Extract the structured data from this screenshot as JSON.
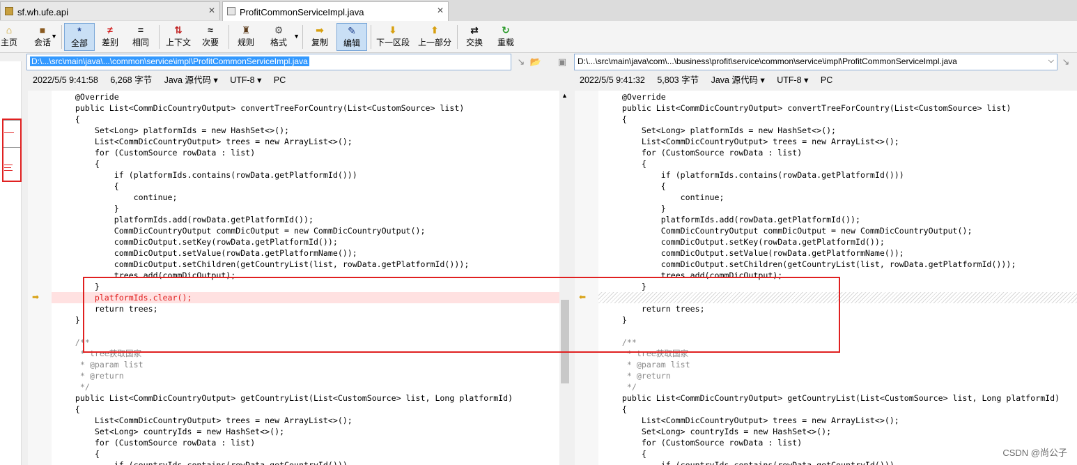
{
  "tabs": [
    {
      "label": "sf.wh.ufe.api"
    },
    {
      "label": "ProfitCommonServiceImpl.java"
    }
  ],
  "toolbar": {
    "home": "主页",
    "session": "会话",
    "all": "全部",
    "diff": "差别",
    "same": "相同",
    "context": "上下文",
    "minor": "次要",
    "rules": "规则",
    "format": "格式",
    "copy": "复制",
    "edit": "编辑",
    "next": "下一区段",
    "prev": "上一部分",
    "swap": "交换",
    "reload": "重载"
  },
  "left": {
    "path": "D:\\...\\src\\main\\java\\...\\common\\service\\impl\\ProfitCommonServiceImpl.java",
    "datetime": "2022/5/5 9:41:58",
    "size": "6,268 字节",
    "lang": "Java 源代码",
    "encoding": "UTF-8",
    "eol": "PC"
  },
  "right": {
    "path": "D:\\...\\src\\main\\java\\com\\...\\business\\profit\\service\\common\\service\\impl\\ProfitCommonServiceImpl.java",
    "datetime": "2022/5/5 9:41:32",
    "size": "5,803 字节",
    "lang": "Java 源代码",
    "encoding": "UTF-8",
    "eol": "PC"
  },
  "code_left": [
    "    @Override",
    "    public List<CommDicCountryOutput> convertTreeForCountry(List<CustomSource> list)",
    "    {",
    "        Set<Long> platformIds = new HashSet<>();",
    "        List<CommDicCountryOutput> trees = new ArrayList<>();",
    "        for (CustomSource rowData : list)",
    "        {",
    "            if (platformIds.contains(rowData.getPlatformId()))",
    "            {",
    "                continue;",
    "            }",
    "            platformIds.add(rowData.getPlatformId());",
    "            CommDicCountryOutput commDicOutput = new CommDicCountryOutput();",
    "            commDicOutput.setKey(rowData.getPlatformId());",
    "            commDicOutput.setValue(rowData.getPlatformName());",
    "            commDicOutput.setChildren(getCountryList(list, rowData.getPlatformId()));",
    "            trees.add(commDicOutput);",
    "        }",
    "        platformIds.clear();",
    "        return trees;",
    "    }",
    "",
    "    /**",
    "     * tree获取国家",
    "     * @param list",
    "     * @return",
    "     */",
    "    public List<CommDicCountryOutput> getCountryList(List<CustomSource> list, Long platformId)",
    "    {",
    "        List<CommDicCountryOutput> trees = new ArrayList<>();",
    "        Set<Long> countryIds = new HashSet<>();",
    "        for (CustomSource rowData : list)",
    "        {",
    "            if (countryIds.contains(rowData.getCountryId()))"
  ],
  "code_right": [
    "    @Override",
    "    public List<CommDicCountryOutput> convertTreeForCountry(List<CustomSource> list)",
    "    {",
    "        Set<Long> platformIds = new HashSet<>();",
    "        List<CommDicCountryOutput> trees = new ArrayList<>();",
    "        for (CustomSource rowData : list)",
    "        {",
    "            if (platformIds.contains(rowData.getPlatformId()))",
    "            {",
    "                continue;",
    "            }",
    "            platformIds.add(rowData.getPlatformId());",
    "            CommDicCountryOutput commDicOutput = new CommDicCountryOutput();",
    "            commDicOutput.setKey(rowData.getPlatformId());",
    "            commDicOutput.setValue(rowData.getPlatformName());",
    "            commDicOutput.setChildren(getCountryList(list, rowData.getPlatformId()));",
    "            trees.add(commDicOutput);",
    "        }",
    "",
    "        return trees;",
    "    }",
    "",
    "    /**",
    "     * tree获取国家",
    "     * @param list",
    "     * @return",
    "     */",
    "    public List<CommDicCountryOutput> getCountryList(List<CustomSource> list, Long platformId)",
    "    {",
    "        List<CommDicCountryOutput> trees = new ArrayList<>();",
    "        Set<Long> countryIds = new HashSet<>();",
    "        for (CustomSource rowData : list)",
    "        {",
    "            if (countryIds.contains(rowData.getCountryId()))"
  ],
  "diff_line_index": 18,
  "watermark": "CSDN @尚公子",
  "colors": {
    "diff_bg": "#ffe1e1",
    "diff_fg": "#e02020",
    "annotation": "#e02020",
    "selection": "#3399ff"
  }
}
